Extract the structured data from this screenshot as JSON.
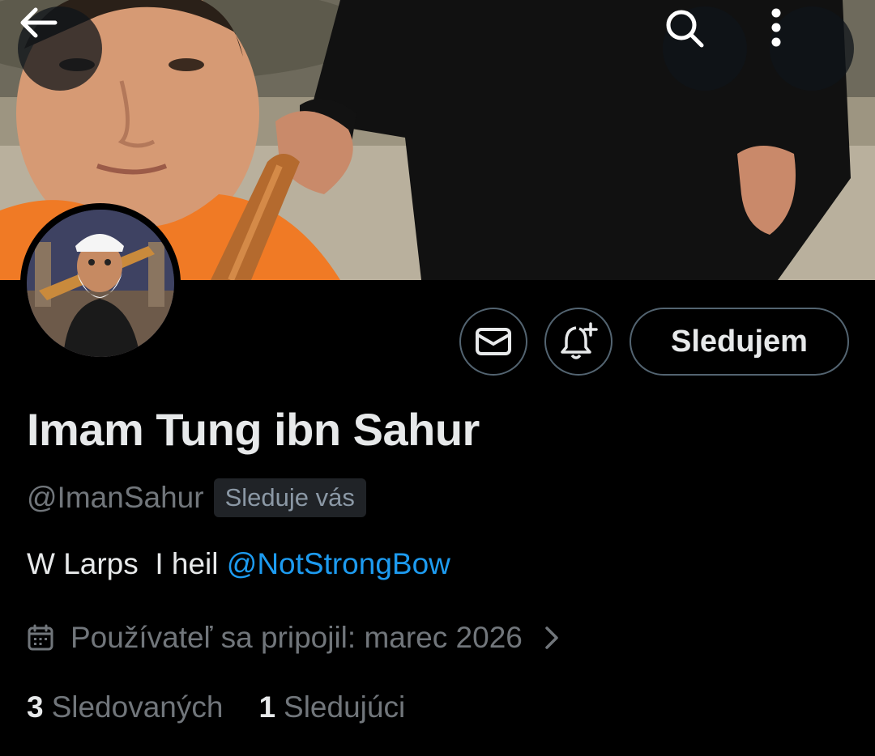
{
  "profile": {
    "display_name": "Imam Tung ibn Sahur",
    "handle": "@ImanSahur",
    "follows_you_badge": "Sleduje vás",
    "bio_text": "W Larps  I heil ",
    "bio_mention": "@NotStrongBow",
    "joined": "Používateľ sa pripojil: marec 2026",
    "following_count": "3",
    "following_label": "Sledovaných",
    "followers_count": "1",
    "followers_label": "Sledujúci"
  },
  "actions": {
    "follow_label": "Sledujem"
  },
  "icons": {
    "back": "arrow-left-icon",
    "search": "search-icon",
    "more": "more-vertical-icon",
    "message": "envelope-icon",
    "notify": "bell-plus-icon",
    "calendar": "calendar-icon",
    "chevron": "chevron-right-icon"
  },
  "colors": {
    "background": "#000000",
    "text_primary": "#e7e9ea",
    "text_secondary": "#71767b",
    "link": "#1d9bf0",
    "border": "#536471",
    "badge_bg": "#202327"
  }
}
